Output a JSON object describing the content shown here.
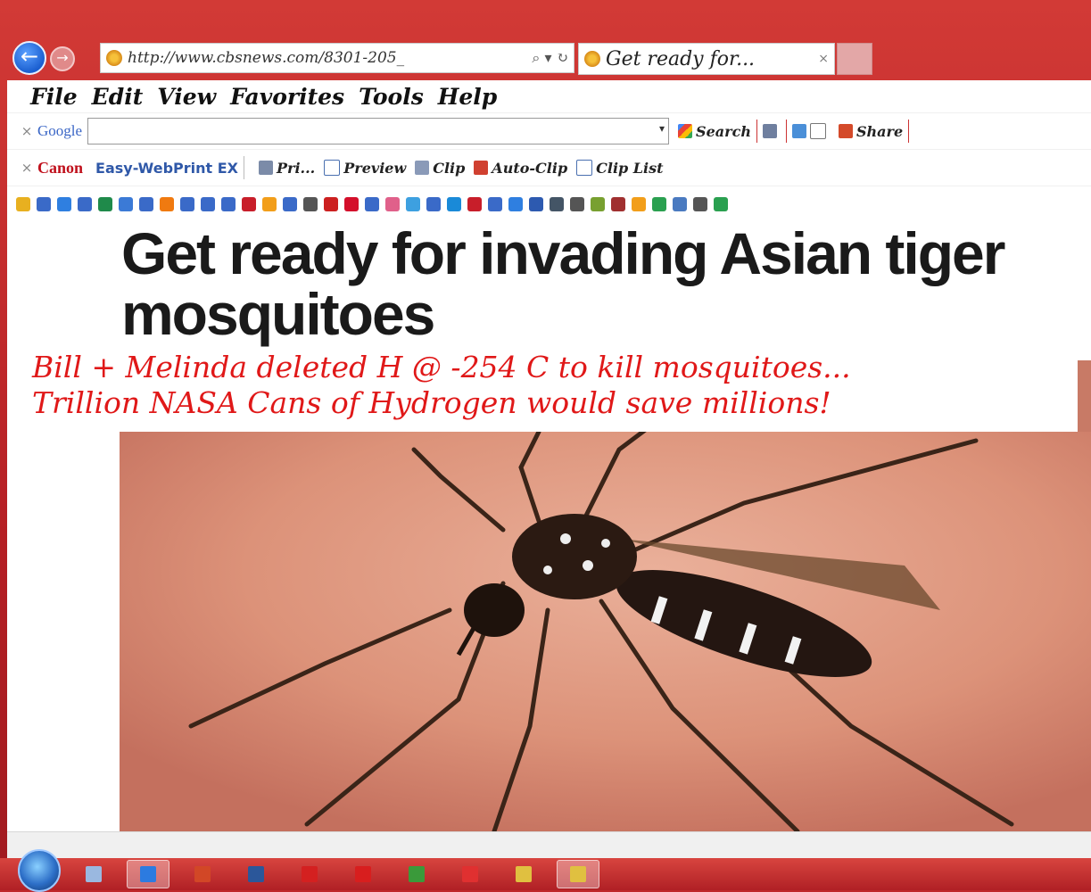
{
  "browser": {
    "address_url": "http://www.cbsnews.com/8301-205_",
    "address_controls": "⌕ ▾ ↻",
    "tab_title": "Get ready for...",
    "tab_close": "×",
    "back_glyph": "←",
    "forward_glyph": "→"
  },
  "menubar": [
    "File",
    "Edit",
    "View",
    "Favorites",
    "Tools",
    "Help"
  ],
  "google_toolbar": {
    "close": "×",
    "brand": "Google",
    "search_value": "",
    "dropdown": "▾",
    "search_label": "Search",
    "share_label": "Share"
  },
  "canon_toolbar": {
    "close": "×",
    "brand": "Canon",
    "ewp_label": "Easy-WebPrint EX",
    "print_label": "Pri...",
    "preview_label": "Preview",
    "clip_label": "Clip",
    "autoclip_label": "Auto-Clip",
    "cliplist_label": "Clip List"
  },
  "favorites_icons": [
    "star-add",
    "page",
    "g-blue",
    "page",
    "globe",
    "circle-blue",
    "page",
    "orange-dot",
    "page",
    "page",
    "page",
    "cvs",
    "amazon-a",
    "page",
    "wiki-w",
    "red-page",
    "k-red",
    "page",
    "pink",
    "blue-page",
    "page",
    "windows",
    "cvs",
    "box-blue",
    "g-blue",
    "shield",
    "dark",
    "wiki-w",
    "leaf",
    "cup",
    "amazon-a",
    "x-green",
    "dots",
    "wiki-w",
    "x-green"
  ],
  "favorites_colors": [
    "#e8b020",
    "#3a6ac8",
    "#2f7fe0",
    "#3a6ac8",
    "#1f8a4a",
    "#3b7ad6",
    "#3a6ac8",
    "#f07a10",
    "#3a6ac8",
    "#3a6ac8",
    "#3a6ac8",
    "#c81e2a",
    "#f29e1a",
    "#3a6ac8",
    "#555555",
    "#cc2020",
    "#d40f2b",
    "#3a6ac8",
    "#e0608a",
    "#3da0e0",
    "#3a6ac8",
    "#1a8ad8",
    "#c81e2a",
    "#3a6ac8",
    "#2f7fe0",
    "#2d5ab0",
    "#445566",
    "#555555",
    "#78a030",
    "#a03030",
    "#f29e1a",
    "#2aa050",
    "#4a7ac0",
    "#555555",
    "#2aa050"
  ],
  "article": {
    "headline": "Get ready for invading Asian tiger mosquitoes",
    "caption_line1": "Bill + Melinda deleted H @ -254 C to kill mosquitoes...",
    "caption_line2": "Trillion NASA Cans of Hydrogen would save millions!"
  },
  "taskbar": {
    "apps": [
      "show-desktop",
      "internet-explorer",
      "powerpoint",
      "word",
      "acrobat",
      "swiss-app",
      "monitor",
      "x-app",
      "window-app",
      "window-app-active"
    ],
    "colors": [
      "#9ab8e0",
      "#2c7be0",
      "#d24726",
      "#2b579a",
      "#d42020",
      "#d81e1e",
      "#3a9a3a",
      "#e03030",
      "#e0c040",
      "#e0c040"
    ]
  }
}
